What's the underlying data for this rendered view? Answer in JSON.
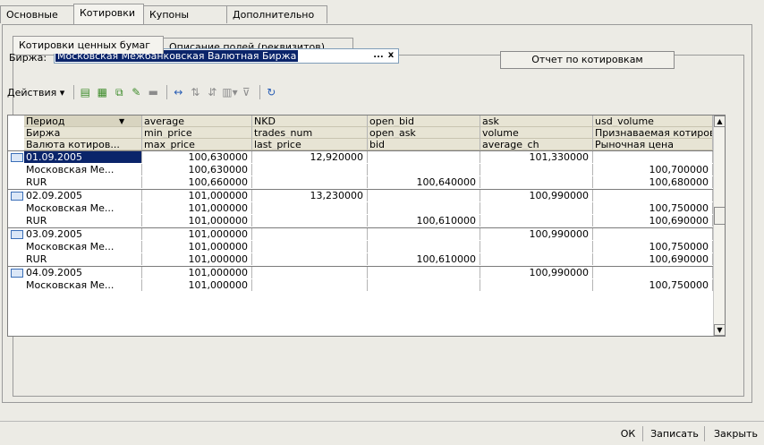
{
  "tabs_top": [
    {
      "label": "Основные"
    },
    {
      "label": "Котировки"
    },
    {
      "label": "Купоны"
    },
    {
      "label": "Дополнительно"
    }
  ],
  "tabs_sub": [
    {
      "label": "Котировки ценных бумаг"
    },
    {
      "label": "Описание полей (реквизитов)"
    }
  ],
  "exchange": {
    "label": "Биржа:",
    "value": "Московская Межбанковская Валютная Биржа",
    "select_btn": "...",
    "clear_btn": "x"
  },
  "report_button": "Отчет по котировкам",
  "toolbar": {
    "actions_label": "Действия ▾"
  },
  "grid": {
    "headers": [
      [
        "Период",
        "average",
        "NKD",
        "open_bid",
        "ask",
        "usd_volume"
      ],
      [
        "Биржа",
        "min_price",
        "trades_num",
        "open_ask",
        "volume",
        "Признаваемая котировка"
      ],
      [
        "Валюта котиров...",
        "max_price",
        "last_price",
        "bid",
        "average_ch",
        "Рыночная цена"
      ]
    ],
    "sort_indicator": "▼",
    "groups": [
      {
        "rows": [
          [
            "01.09.2005",
            "100,630000",
            "12,920000",
            "",
            "101,330000",
            ""
          ],
          [
            "Московская Ме...",
            "100,630000",
            "",
            "",
            "",
            "100,700000"
          ],
          [
            "RUR",
            "100,660000",
            "",
            "100,640000",
            "",
            "100,680000"
          ]
        ]
      },
      {
        "rows": [
          [
            "02.09.2005",
            "101,000000",
            "13,230000",
            "",
            "100,990000",
            ""
          ],
          [
            "Московская Ме...",
            "101,000000",
            "",
            "",
            "",
            "100,750000"
          ],
          [
            "RUR",
            "101,000000",
            "",
            "100,610000",
            "",
            "100,690000"
          ]
        ]
      },
      {
        "rows": [
          [
            "03.09.2005",
            "101,000000",
            "",
            "",
            "100,990000",
            ""
          ],
          [
            "Московская Ме...",
            "101,000000",
            "",
            "",
            "",
            "100,750000"
          ],
          [
            "RUR",
            "101,000000",
            "",
            "100,610000",
            "",
            "100,690000"
          ]
        ]
      },
      {
        "rows": [
          [
            "04.09.2005",
            "101,000000",
            "",
            "",
            "100,990000",
            ""
          ],
          [
            "Московская Ме...",
            "101,000000",
            "",
            "",
            "",
            "100,750000"
          ]
        ]
      }
    ]
  },
  "bottom": {
    "ok": "ОК",
    "save": "Записать",
    "close": "Закрыть"
  },
  "colors": {
    "selection": "#0a246a",
    "header_bg": "#e7e4d4"
  }
}
